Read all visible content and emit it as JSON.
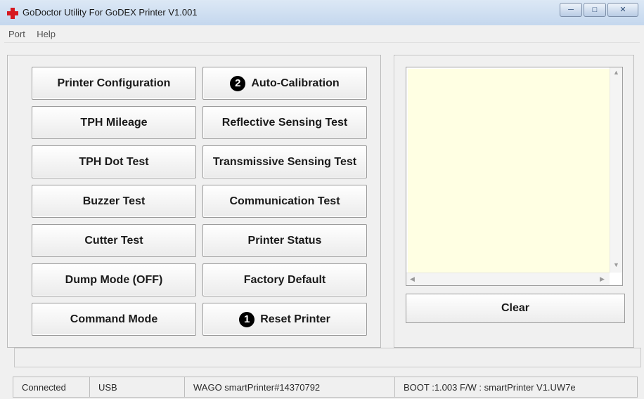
{
  "window": {
    "title": "GoDoctor Utility For GoDEX Printer  V1.001",
    "controls": [
      "minimize-icon",
      "maximize-icon",
      "close-icon"
    ]
  },
  "menu": [
    "Port",
    "Help"
  ],
  "buttons_left": [
    "Printer Configuration",
    "TPH Mileage",
    "TPH Dot Test",
    "Buzzer Test",
    "Cutter Test",
    "Dump Mode (OFF)",
    "Command Mode"
  ],
  "buttons_right": [
    {
      "label": "Auto-Calibration",
      "badge": "2"
    },
    {
      "label": "Reflective Sensing Test"
    },
    {
      "label": "Transmissive Sensing Test"
    },
    {
      "label": "Communication Test"
    },
    {
      "label": "Printer Status"
    },
    {
      "label": "Factory Default"
    },
    {
      "label": "Reset Printer",
      "badge": "1"
    }
  ],
  "log_output": {
    "text": ""
  },
  "clear_button": "Clear",
  "status": {
    "connection": "Connected",
    "port": "USB",
    "printer": "WAGO smartPrinter#14370792",
    "firmware": "BOOT :1.003  F/W : smartPrinter V1.UW7e"
  },
  "colors": {
    "log_background": "#ffffe3",
    "title_gradient_top": "#dce8f5",
    "title_gradient_bottom": "#c4d7ee",
    "badge": "#000000",
    "app_icon": "#d6181f"
  }
}
